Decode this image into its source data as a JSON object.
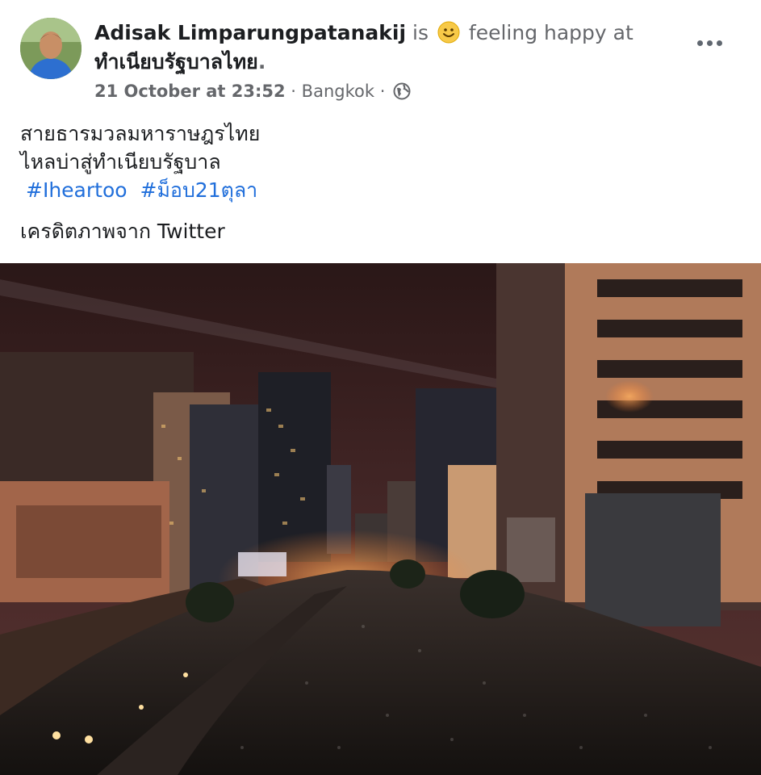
{
  "post": {
    "author": "Adisak Limparungpatanakij",
    "is_text": "is",
    "feeling_text": "feeling happy at",
    "location_page": "ทำเนียบรัฐบาลไทย",
    "location_period": ".",
    "timestamp": "21 October at 23:52",
    "separator": "·",
    "place": "Bangkok",
    "separator2": "·",
    "body_lines": [
      "สายธารมวลมหาราษฎรไทย",
      "ไหลบ่าสู่ทำเนียบรัฐบาล"
    ],
    "hashtags": [
      "#Iheartoo",
      "#ม็อบ21ตุลา"
    ],
    "credit": "เครดิตภาพจาก Twitter"
  },
  "icons": {
    "avatar": "profile-photo",
    "emoji": "smiling-face-emoji",
    "privacy": "globe-icon",
    "menu": "more-options-icon"
  },
  "colors": {
    "link": "#216fdb",
    "muted": "#65676b",
    "text": "#1c1e21"
  }
}
